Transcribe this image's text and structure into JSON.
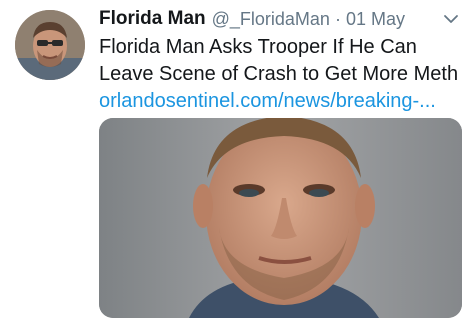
{
  "tweet": {
    "display_name": "Florida Man",
    "handle": "@_FloridaMan",
    "separator": "·",
    "date": "01 May",
    "text": "Florida Man Asks Trooper If He Can Leave Scene of Crash to Get More Meth",
    "link_text": "orlandosentinel.com/news/breaking-..."
  },
  "icons": {
    "menu": "chevron-down-icon"
  },
  "colors": {
    "name": "#14171a",
    "secondary": "#657786",
    "link": "#1b95e0"
  }
}
